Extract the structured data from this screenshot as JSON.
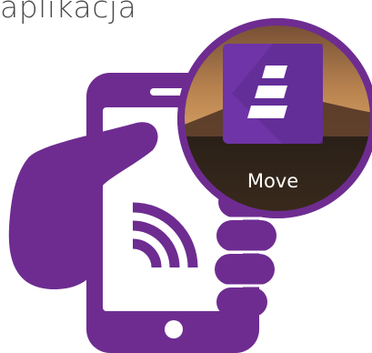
{
  "caption": "aplikacja",
  "app": {
    "label": "Move",
    "icon": "move-app-icon"
  },
  "colors": {
    "brand_purple": "#6e2c91",
    "icon_purple": "#6f34a7",
    "caption_gray": "#4a4a4a"
  },
  "icons": {
    "phone": "smartphone-icon",
    "hand": "hand-icon",
    "signal": "wireless-signal-icon"
  }
}
